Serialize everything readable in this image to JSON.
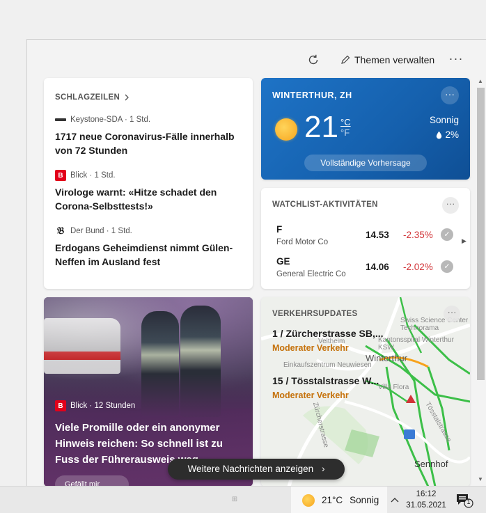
{
  "header": {
    "manage_label": "Themen verwalten",
    "more_label": "···"
  },
  "headlines": {
    "title": "SCHLAGZEILEN",
    "items": [
      {
        "source": "Keystone-SDA · 1 Std.",
        "text": "1717 neue Coronavirus-Fälle innerhalb von 72 Stunden"
      },
      {
        "source": "Blick · 1 Std.",
        "text": "Virologe warnt: «Hitze schadet den Corona-Selbsttests!»"
      },
      {
        "source": "Der Bund · 1 Std.",
        "text": "Erdogans Geheimdienst nimmt Gülen-Neffen im Ausland fest"
      }
    ]
  },
  "weather": {
    "location": "WINTERTHUR, ZH",
    "temp": "21",
    "unit_c": "°C",
    "unit_f": "°F",
    "condition": "Sonnig",
    "rain": "2%",
    "forecast_label": "Vollständige Vorhersage",
    "more_label": "···"
  },
  "watchlist": {
    "title": "WATCHLIST-AKTIVITÄTEN",
    "more_label": "···",
    "items": [
      {
        "symbol": "F",
        "name": "Ford Motor Co",
        "price": "14.53",
        "change": "-2.35%"
      },
      {
        "symbol": "GE",
        "name": "General Electric Co",
        "price": "14.06",
        "change": "-2.02%"
      }
    ],
    "colors": {
      "negative": "#d13438"
    }
  },
  "news": {
    "source": "Blick · 12 Stunden",
    "title": "Viele Promille oder ein anonymer Hinweis reichen: So schnell ist zu Fuss der Führerausweis weg",
    "react_label": "Gefällt mir"
  },
  "traffic": {
    "title": "VERKEHRSUPDATES",
    "more_label": "···",
    "routes": [
      {
        "road": "1 / Zürcherstrasse SB,...",
        "status": "Moderater Verkehr"
      },
      {
        "road": "15 / Tösstalstrasse W...",
        "status": "Moderater Verkehr"
      }
    ],
    "map_labels": [
      "Swiss Science Center Technorama",
      "Kantonsspital Winterthur KSW",
      "Veltheim",
      "Einkaufszentrum Neuwiesen",
      "Winterthur",
      "Villa Flora",
      "Tösstalstrasse",
      "Sennhof",
      "Zürcherstrasse"
    ],
    "colors": {
      "moderate": "#c5710a",
      "road_green": "#3cbf48"
    }
  },
  "more_news_label": "Weitere Nachrichten anzeigen",
  "taskbar": {
    "weather_temp": "21°C",
    "weather_condition": "Sonnig",
    "time": "16:12",
    "date": "31.05.2021",
    "notification_count": "1"
  }
}
